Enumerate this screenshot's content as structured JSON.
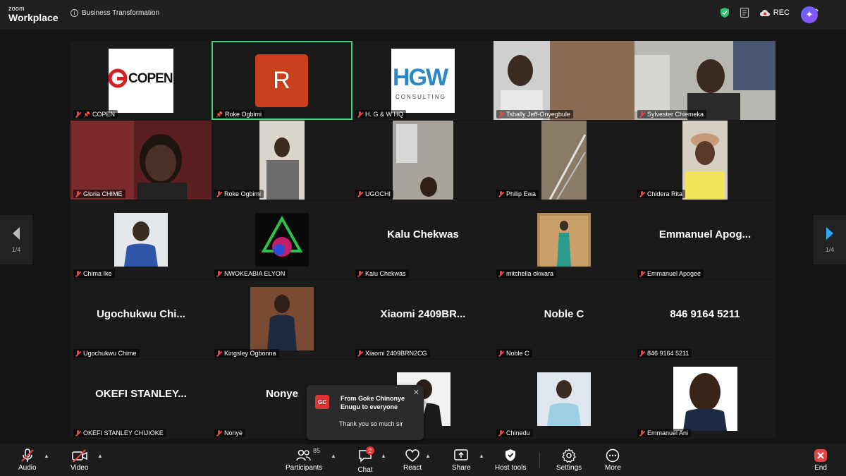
{
  "topbar": {
    "brand_line1": "zoom",
    "brand_line2": "Workplace",
    "meeting_title": "Business Transformation",
    "rec_label": "REC"
  },
  "gallery": {
    "page_indicator_left": "1/4",
    "page_indicator_right": "1/4",
    "tiles": [
      {
        "label": "COPEN",
        "logo_text": "COPEN"
      },
      {
        "label": "Roke Ogbimi",
        "avatar_letter": "R"
      },
      {
        "label": "H. G & W HQ",
        "logo_text": "HGW",
        "logo_sub": "CONSULTING"
      },
      {
        "label": "Tshally Jeff-Onyegbule"
      },
      {
        "label": "Sylvester Chiemeka"
      },
      {
        "label": "Gloria CHIME"
      },
      {
        "label": "Roke Ogbimi"
      },
      {
        "label": "UGOCHI"
      },
      {
        "label": "Philip Ewa"
      },
      {
        "label": "Chidera Rita"
      },
      {
        "label": "Chima Ike"
      },
      {
        "label": "NWOKEABIA ELYON"
      },
      {
        "label": "Kalu Chekwas",
        "big": "Kalu Chekwas"
      },
      {
        "label": "mitchella okwara"
      },
      {
        "label": "Emmanuel Apogee",
        "big": "Emmanuel  Apog..."
      },
      {
        "label": "Ugochukwu Chime",
        "big": "Ugochukwu  Chi..."
      },
      {
        "label": "Kingsley Ogbonna"
      },
      {
        "label": "Xiaomi 2409BRN2CG",
        "big": "Xiaomi  2409BR..."
      },
      {
        "label": "Noble C",
        "big": "Noble C"
      },
      {
        "label": "846 9164 5211",
        "big": "846 9164 5211"
      },
      {
        "label": "OKEFI STANLEY CHIJIOKE",
        "big": "OKEFI  STANLEY..."
      },
      {
        "label": "Nonye",
        "big": "Nonye"
      },
      {
        "label": ""
      },
      {
        "label": "Chinedu"
      },
      {
        "label": "Emmanuel Ani"
      }
    ]
  },
  "chat_toast": {
    "initials": "GC",
    "from": "From Goke Chinonye Enugu to everyone",
    "message": "Thank you so much sir"
  },
  "toolbar": {
    "audio": "Audio",
    "video": "Video",
    "participants": "Participants",
    "participants_count": "85",
    "chat": "Chat",
    "chat_badge": "2",
    "react": "React",
    "share": "Share",
    "host_tools": "Host tools",
    "settings": "Settings",
    "more": "More",
    "end": "End"
  },
  "colors": {
    "active_speaker": "#3fcf7f",
    "mute_red": "#e64545",
    "avatar_r": "#c8401c"
  }
}
